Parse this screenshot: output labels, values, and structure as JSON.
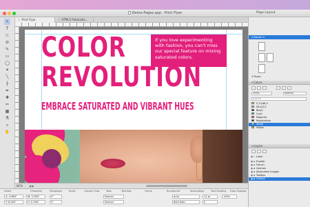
{
  "window": {
    "title": "Demo-Pages.qxp : Print Flyer",
    "panel_title": "Page Layout"
  },
  "tabs": [
    {
      "label": "Print Flyer",
      "active": true
    },
    {
      "label": "HTML5 Publicatio...",
      "active": false
    }
  ],
  "document": {
    "headline_line1": "COLOR",
    "headline_line2": "REVOLUTION",
    "subhead": "EMBRACE SATURATED AND VIBRANT HUES",
    "promo_text": "If you love experimenting with fashion, you can't miss our special feature on mixing saturated colors.",
    "accent_color": "#e31f7c"
  },
  "statusbar": {
    "zoom": "81%"
  },
  "page_layout": {
    "master": "A-Master A",
    "pages_count": "4 Pages"
  },
  "colors_panel": {
    "title": "Colors",
    "opacity": "100%",
    "blend": "Normal",
    "search_placeholder": "Search",
    "items": [
      {
        "name": "0,74,88,0",
        "color": "#f0b43a"
      },
      {
        "name": "56,6,0,0",
        "color": "#6fc2e8"
      },
      {
        "name": "Black",
        "color": "#000000"
      },
      {
        "name": "Cyan",
        "color": "#00a3e0"
      },
      {
        "name": "Magenta",
        "color": "#e31f7c"
      },
      {
        "name": "Registration",
        "color": "#111111"
      },
      {
        "name": "White",
        "color": "#ffffff",
        "selected": true
      },
      {
        "name": "Yellow",
        "color": "#ffe100"
      }
    ]
  },
  "layers_panel": {
    "title": "Layers",
    "items": [
      {
        "name": "Layer",
        "selected": false
      },
      {
        "name": "English",
        "selected": false
      },
      {
        "name": "French",
        "selected": false
      },
      {
        "name": "German",
        "selected": false
      },
      {
        "name": "Alternative Images",
        "selected": false
      },
      {
        "name": "Tooltips",
        "selected": false
      },
      {
        "name": "Default",
        "selected": true
      }
    ]
  },
  "measurements": {
    "tabs": [
      "Home",
      "Character",
      "Paragraph",
      "Rules",
      "Column Flow",
      "Tabs",
      "Text Box",
      "Frame",
      "Runaround",
      "Space/Align",
      "Text Shading",
      "Drop Shadow"
    ],
    "x": "X: 4.988\"",
    "y": "Y: 8.283\"",
    "w": "W: 3.558\"",
    "h": "H: 0.358\"",
    "angle": "0°",
    "size": "0\"",
    "font": "Normal",
    "font_style": "Normal",
    "typeface": "Arial",
    "weight": "Bold Italic",
    "font_size": "12 pt",
    "tracking": "0",
    "scale": "100%"
  }
}
